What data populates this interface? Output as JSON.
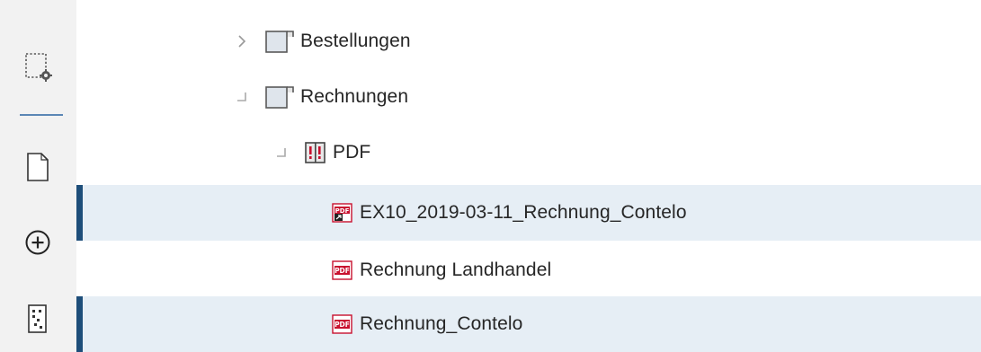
{
  "toolbar": {
    "buttons": [
      {
        "icon": "selection-settings-icon"
      },
      {
        "icon": "new-document-icon"
      },
      {
        "icon": "add-circle-icon"
      },
      {
        "icon": "barcode-sheet-icon"
      }
    ]
  },
  "tree": {
    "items": [
      {
        "label": "Bestellungen",
        "expander": "collapsed",
        "icon": "folder-icon"
      },
      {
        "label": "Rechnungen",
        "expander": "expanded",
        "icon": "folder-icon"
      },
      {
        "label": "PDF",
        "expander": "expanded",
        "icon": "register-icon"
      },
      {
        "label": "EX10_2019-03-11_Rechnung_Contelo",
        "icon": "pdf-link-icon",
        "selected": true
      },
      {
        "label": "Rechnung Landhandel",
        "icon": "pdf-icon",
        "selected": false
      },
      {
        "label": "Rechnung_Contelo",
        "icon": "pdf-icon",
        "selected": true
      }
    ]
  },
  "colors": {
    "toolbar_bg": "#f2f2f2",
    "selection_bg": "#e6eef5",
    "selection_bar": "#1e4e7a",
    "separator": "#5b87b5",
    "pdf_red": "#c8102e"
  }
}
